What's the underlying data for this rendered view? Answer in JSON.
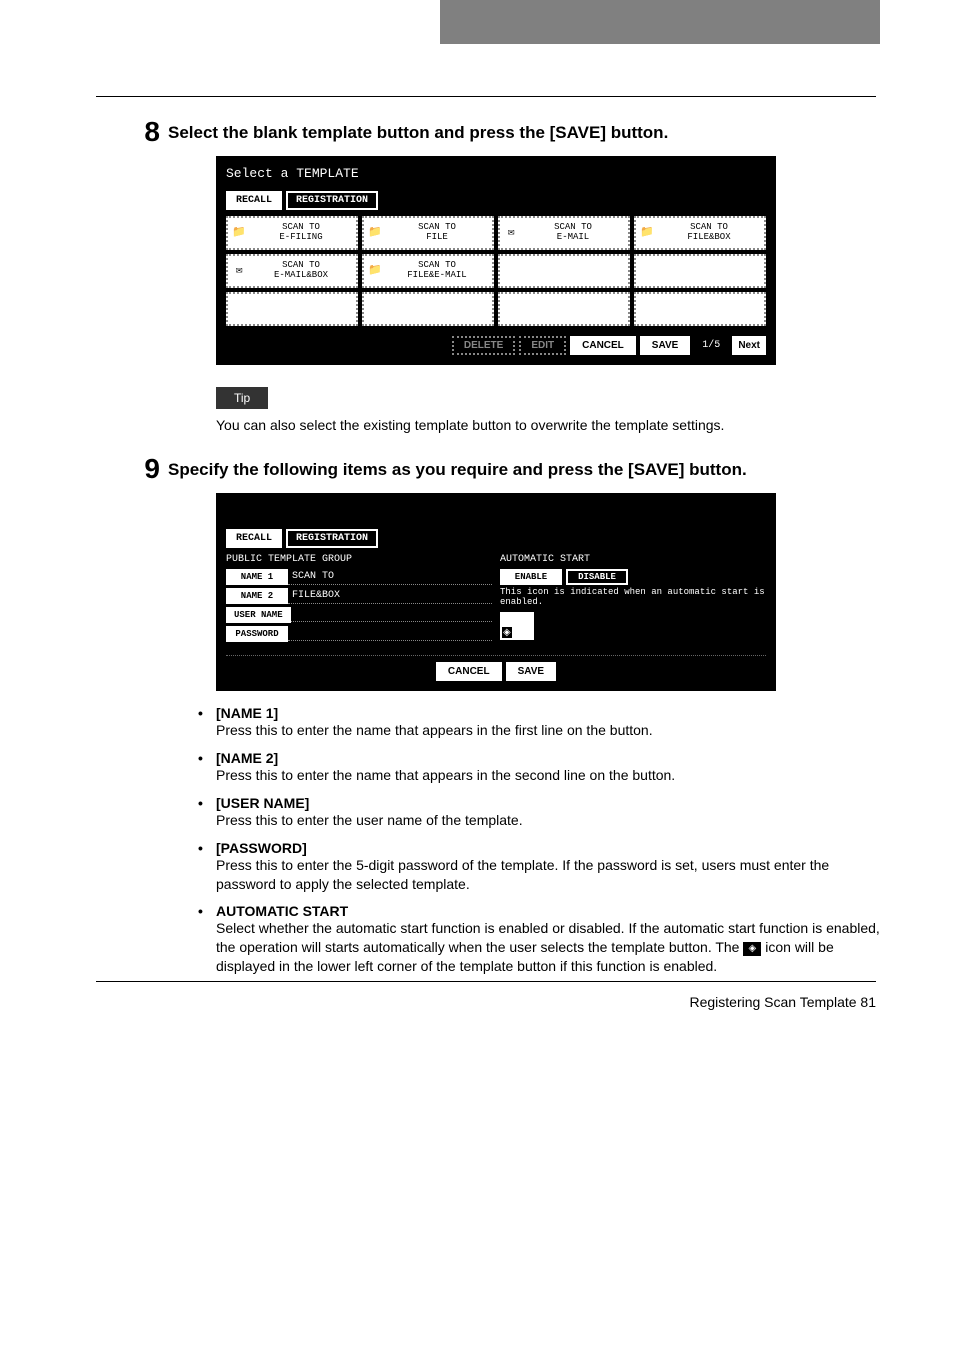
{
  "step8": {
    "number": "8",
    "title": "Select the blank template button and press the [SAVE] button.",
    "screen": {
      "title": "Select a TEMPLATE",
      "tabs": {
        "recall": "RECALL",
        "registration": "REGISTRATION"
      },
      "templates": [
        {
          "line1": "SCAN TO",
          "line2": "E-FILING"
        },
        {
          "line1": "SCAN TO",
          "line2": "FILE"
        },
        {
          "line1": "SCAN TO",
          "line2": "E-MAIL"
        },
        {
          "line1": "SCAN TO",
          "line2": "FILE&BOX"
        },
        {
          "line1": "SCAN TO",
          "line2": "E-MAIL&BOX"
        },
        {
          "line1": "SCAN TO",
          "line2": "FILE&E-MAIL"
        },
        {
          "line1": "",
          "line2": ""
        },
        {
          "line1": "",
          "line2": ""
        },
        {
          "line1": "",
          "line2": ""
        },
        {
          "line1": "",
          "line2": ""
        },
        {
          "line1": "",
          "line2": ""
        },
        {
          "line1": "",
          "line2": ""
        }
      ],
      "buttons": {
        "delete": "DELETE",
        "edit": "EDIT",
        "cancel": "CANCEL",
        "save": "SAVE",
        "next": "Next"
      },
      "page_indicator": "1/5"
    }
  },
  "tip": {
    "label": "Tip",
    "text": "You can also select the existing template button to overwrite the template settings."
  },
  "step9": {
    "number": "9",
    "title": "Specify the following items as you require and press the [SAVE] button.",
    "screen": {
      "tabs": {
        "recall": "RECALL",
        "registration": "REGISTRATION"
      },
      "group_label": "PUBLIC TEMPLATE GROUP",
      "auto_label": "AUTOMATIC START",
      "fields": {
        "name1_btn": "NAME 1",
        "name1_val": "SCAN TO",
        "name2_btn": "NAME 2",
        "name2_val": "FILE&BOX",
        "username_btn": "USER NAME",
        "username_val": "",
        "password_btn": "PASSWORD",
        "password_val": ""
      },
      "enable": "ENABLE",
      "disable": "DISABLE",
      "note": "This icon is indicated when an automatic start is enabled.",
      "buttons": {
        "cancel": "CANCEL",
        "save": "SAVE"
      }
    }
  },
  "defs": {
    "name1": {
      "title": "[NAME 1]",
      "desc": "Press this to enter the name that appears in the first line on the button."
    },
    "name2": {
      "title": "[NAME 2]",
      "desc": "Press this to enter the name that appears in the second line on the button."
    },
    "username": {
      "title": "[USER NAME]",
      "desc": "Press this to enter the user name of the template."
    },
    "password": {
      "title": "[PASSWORD]",
      "desc": "Press this to enter the 5-digit password of the template.  If the password is set, users must enter the password to apply the selected template."
    },
    "autostart": {
      "title": "AUTOMATIC START",
      "desc_a": "Select whether the automatic start function is enabled or disabled.  If the automatic start function is enabled, the operation will starts automatically when the user selects the template button.  The ",
      "desc_b": " icon will be displayed in the lower left corner of the template button if this function is enabled."
    }
  },
  "footer": {
    "text": "Registering Scan Template    81"
  }
}
